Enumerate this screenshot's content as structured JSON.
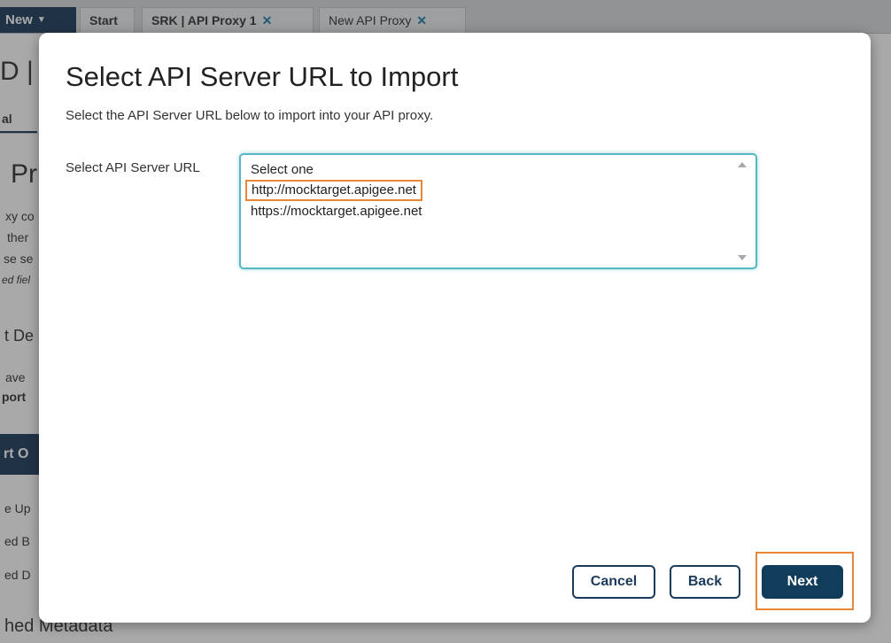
{
  "background": {
    "new_label": "New",
    "tabs": [
      {
        "label": "Start"
      },
      {
        "label": "SRK | API Proxy 1",
        "close": "✕"
      },
      {
        "label": "New API Proxy",
        "close": "✕"
      }
    ],
    "fragments": {
      "f1": "D |",
      "f2": "al",
      "f3": "Pr",
      "f4": "xy co",
      "f5": "ther",
      "f6": "se se",
      "f7": "ed fiel",
      "f8": "t De",
      "f9": "ave",
      "f10": "port",
      "f11": "rt O",
      "f12": "e Up",
      "f13": "ed B",
      "f14": "ed D",
      "f15": "hed Metadata"
    }
  },
  "modal": {
    "title": "Select API Server URL to Import",
    "subtitle": "Select the API Server URL below to import into your API proxy.",
    "field_label": "Select API Server URL",
    "options": [
      "Select one",
      "http://mocktarget.apigee.net",
      "https://mocktarget.apigee.net"
    ],
    "highlighted_option_index": 1,
    "highlight_color": "#e8873a",
    "cancel_label": "Cancel",
    "back_label": "Back",
    "next_label": "Next"
  },
  "colors": {
    "primary": "#123d5a",
    "focus": "#57b7c4",
    "annotation": "#e8873a"
  }
}
